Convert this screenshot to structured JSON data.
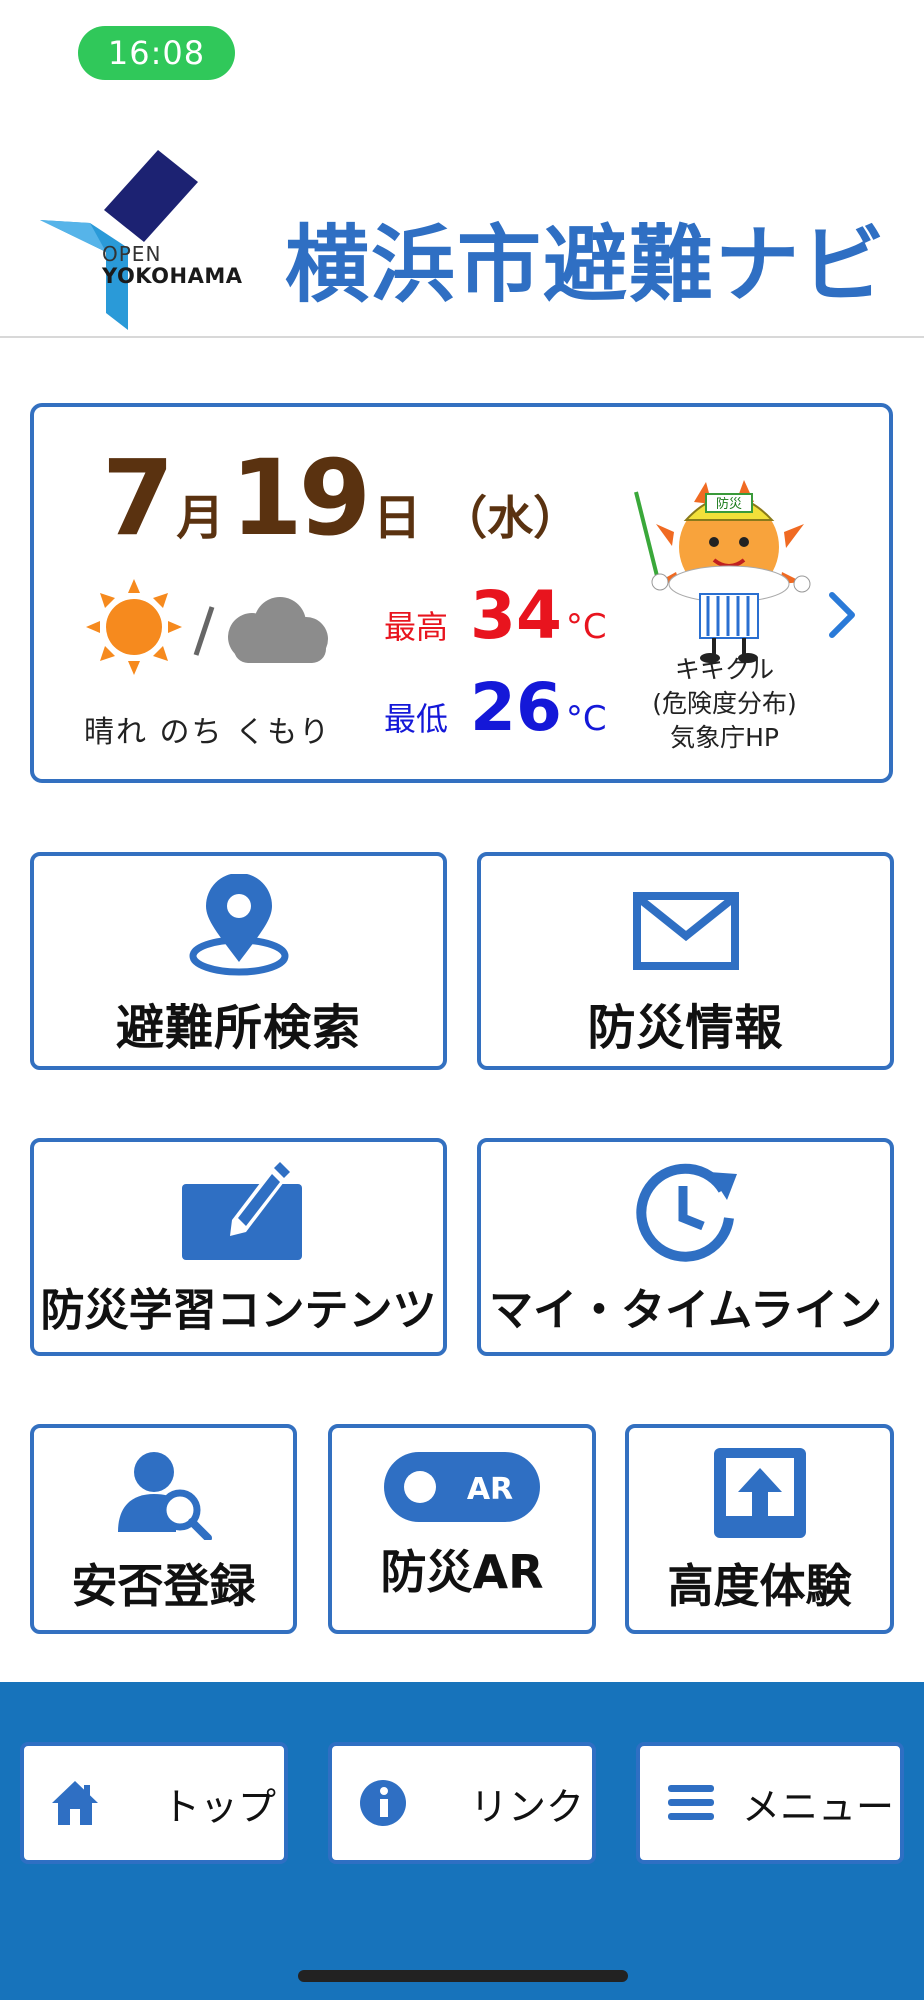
{
  "status_bar": {
    "time": "16:08",
    "pill_color": "#30c85a"
  },
  "header": {
    "logo_open": "OPEN",
    "logo_yokohama": "YOKOHAMA",
    "title": "横浜市避難ナビ",
    "title_color": "#2f6fc3"
  },
  "weather": {
    "month": "7",
    "month_unit": "月",
    "day": "19",
    "day_unit": "日",
    "weekday": "（水）",
    "condition_icons": [
      "sun-icon",
      "cloud-icon"
    ],
    "condition_text": "晴れ のち くもり",
    "high_label": "最高",
    "high_value": "34",
    "low_label": "最低",
    "low_value": "26",
    "unit": "°C",
    "high_color": "#e8141e",
    "low_color": "#1418d8",
    "kikikuru_line1": "キキクル",
    "kikikuru_line2": "(危険度分布)",
    "kikikuru_line3": "気象庁HP",
    "mascot_badge": "防災"
  },
  "tiles": {
    "shelter_search": "避難所検索",
    "disaster_info": "防災情報",
    "learning": "防災学習コンテンツ",
    "timeline": "マイ・タイムライン",
    "safety_reg": "安否登録",
    "ar": "防災AR",
    "ar_badge": "AR",
    "altitude": "高度体験"
  },
  "bottom_nav": {
    "top": "トップ",
    "link": "リンク",
    "menu": "メニュー",
    "bar_color": "#1773bb"
  },
  "accent_color": "#3370c0"
}
